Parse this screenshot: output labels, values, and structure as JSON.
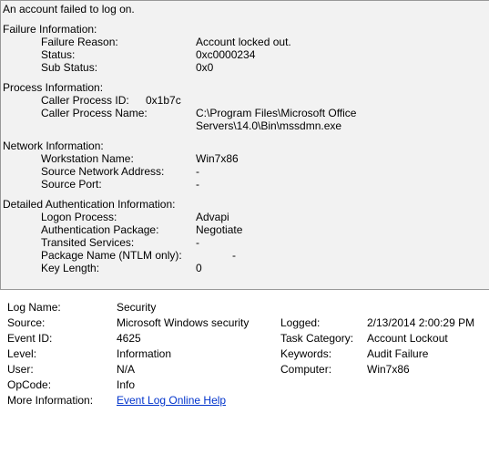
{
  "message": "An account failed to log on.",
  "failure": {
    "title": "Failure Information:",
    "reason_label": "Failure Reason:",
    "reason_value": "Account locked out.",
    "status_label": "Status:",
    "status_value": "0xc0000234",
    "substatus_label": "Sub Status:",
    "substatus_value": "0x0"
  },
  "process": {
    "title": "Process Information:",
    "caller_id_label": "Caller Process ID:",
    "caller_id_value": "0x1b7c",
    "caller_name_label": "Caller Process Name:",
    "caller_name_value": "C:\\Program Files\\Microsoft Office Servers\\14.0\\Bin\\mssdmn.exe"
  },
  "network": {
    "title": "Network Information:",
    "workstation_label": "Workstation Name:",
    "workstation_value": "Win7x86",
    "source_addr_label": "Source Network Address:",
    "source_addr_value": "-",
    "source_port_label": "Source Port:",
    "source_port_value": "-"
  },
  "auth": {
    "title": "Detailed Authentication Information:",
    "logon_process_label": "Logon Process:",
    "logon_process_value": "Advapi",
    "auth_package_label": "Authentication Package:",
    "auth_package_value": "Negotiate",
    "transited_label": "Transited Services:",
    "transited_value": "-",
    "ntlm_label": "Package Name (NTLM only):",
    "ntlm_value": "-",
    "keylen_label": "Key Length:",
    "keylen_value": "0"
  },
  "event": {
    "logname_label": "Log Name:",
    "logname_value": "Security",
    "source_label": "Source:",
    "source_value": "Microsoft Windows security",
    "logged_label": "Logged:",
    "logged_value": "2/13/2014 2:00:29 PM",
    "eventid_label": "Event ID:",
    "eventid_value": "4625",
    "taskcat_label": "Task Category:",
    "taskcat_value": "Account Lockout",
    "level_label": "Level:",
    "level_value": "Information",
    "keywords_label": "Keywords:",
    "keywords_value": "Audit Failure",
    "user_label": "User:",
    "user_value": "N/A",
    "computer_label": "Computer:",
    "computer_value": "Win7x86",
    "opcode_label": "OpCode:",
    "opcode_value": "Info",
    "moreinfo_label": "More Information:",
    "moreinfo_link": "Event Log Online Help"
  }
}
